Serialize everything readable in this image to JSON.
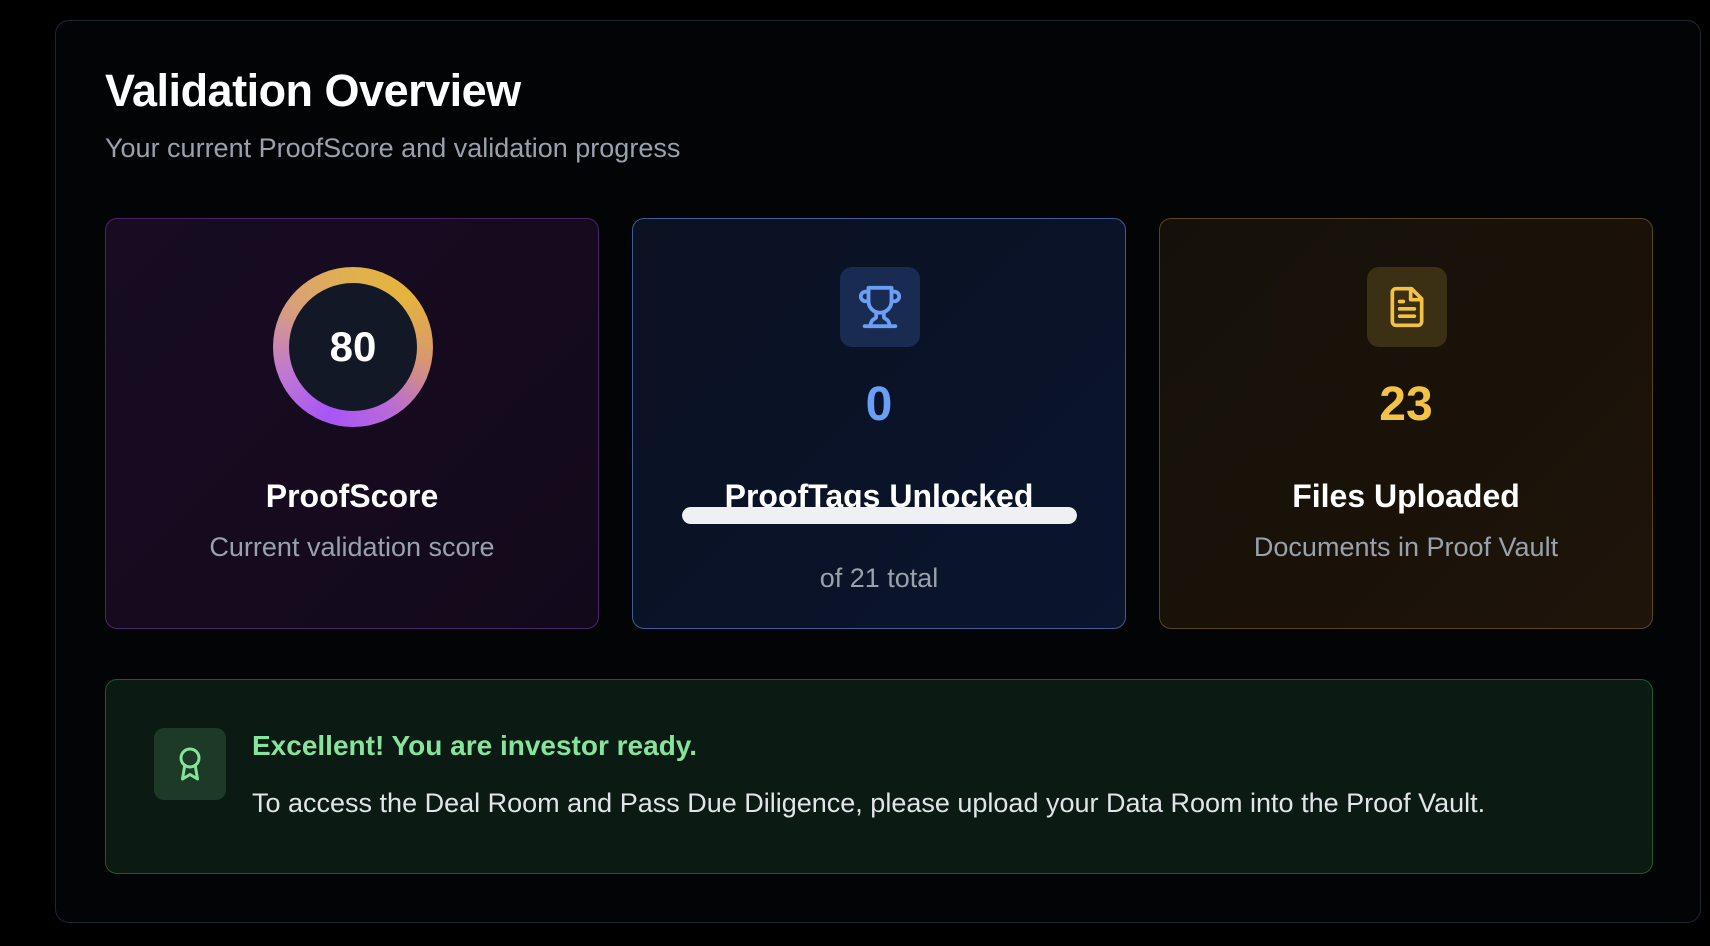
{
  "header": {
    "title": "Validation Overview",
    "subtitle": "Your current ProofScore and validation progress"
  },
  "cards": {
    "proofscore": {
      "value": "80",
      "label": "ProofScore",
      "description": "Current validation score",
      "ring_colors": [
        "#a855f7",
        "#e6b43c"
      ]
    },
    "prooftags": {
      "icon": "trophy-icon",
      "value": "0",
      "label": "ProofTags Unlocked",
      "progress": 1.0,
      "total_text": "of 21 total",
      "accent": "#6b9ef5"
    },
    "files": {
      "icon": "document-icon",
      "value": "23",
      "label": "Files Uploaded",
      "description": "Documents in Proof Vault",
      "accent": "#f2c344"
    }
  },
  "banner": {
    "icon": "award-icon",
    "title": "Excellent! You are investor ready.",
    "message": "To access the Deal Room and Pass Due Diligence, please upload your Data Room into the Proof Vault.",
    "accent": "#86e39c"
  }
}
